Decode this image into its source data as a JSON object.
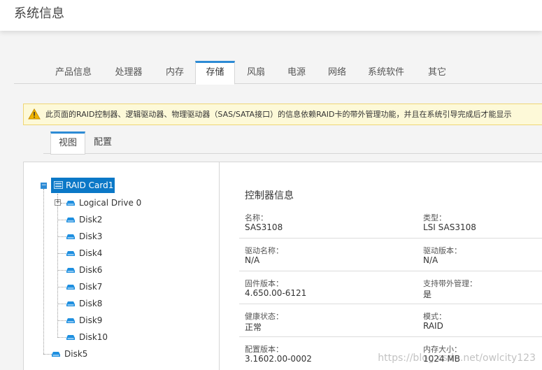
{
  "header": {
    "title": "系统信息"
  },
  "main_tabs": [
    "产品信息",
    "处理器",
    "内存",
    "存储",
    "风扇",
    "电源",
    "网络",
    "系统软件",
    "其它"
  ],
  "main_tab_active": "存储",
  "warning": {
    "text": "此页面的RAID控制器、逻辑驱动器、物理驱动器（SAS/SATA接口）的信息依赖RAID卡的带外管理功能，并且在系统引导完成后才能显示"
  },
  "sub_tabs": [
    "视图",
    "配置"
  ],
  "sub_tab_active": "视图",
  "tree": {
    "root": "RAID Card1",
    "children": [
      {
        "label": "Logical Drive 0",
        "expandable": true
      },
      {
        "label": "Disk2"
      },
      {
        "label": "Disk3"
      },
      {
        "label": "Disk4"
      },
      {
        "label": "Disk6"
      },
      {
        "label": "Disk7"
      },
      {
        "label": "Disk8"
      },
      {
        "label": "Disk9"
      },
      {
        "label": "Disk10"
      }
    ],
    "sibling": "Disk5"
  },
  "controller": {
    "heading": "控制器信息",
    "rows": [
      [
        {
          "label": "名称：",
          "value": "SAS3108"
        },
        {
          "label": "类型：",
          "value": "LSI SAS3108"
        }
      ],
      [
        {
          "label": "驱动名称：",
          "value": "N/A"
        },
        {
          "label": "驱动版本：",
          "value": "N/A"
        }
      ],
      [
        {
          "label": "固件版本：",
          "value": "4.650.00-6121"
        },
        {
          "label": "支持带外管理：",
          "value": "是"
        }
      ],
      [
        {
          "label": "健康状态：",
          "value": "正常"
        },
        {
          "label": "模式：",
          "value": "RAID"
        }
      ],
      [
        {
          "label": "配置版本：",
          "value": "3.1602.00-0002"
        },
        {
          "label": "内存大小：",
          "value": "1024 MB"
        }
      ]
    ]
  },
  "watermark": "https://blog.csdn.net/owlcity123",
  "colors": {
    "accent": "#2d8bd5",
    "tree_selected": "#0b78c7",
    "warning_bg": "#fdf9d8",
    "warning_icon": "#f0b400"
  },
  "icons": {
    "warning": "warning-icon",
    "disk": "disk-icon"
  }
}
